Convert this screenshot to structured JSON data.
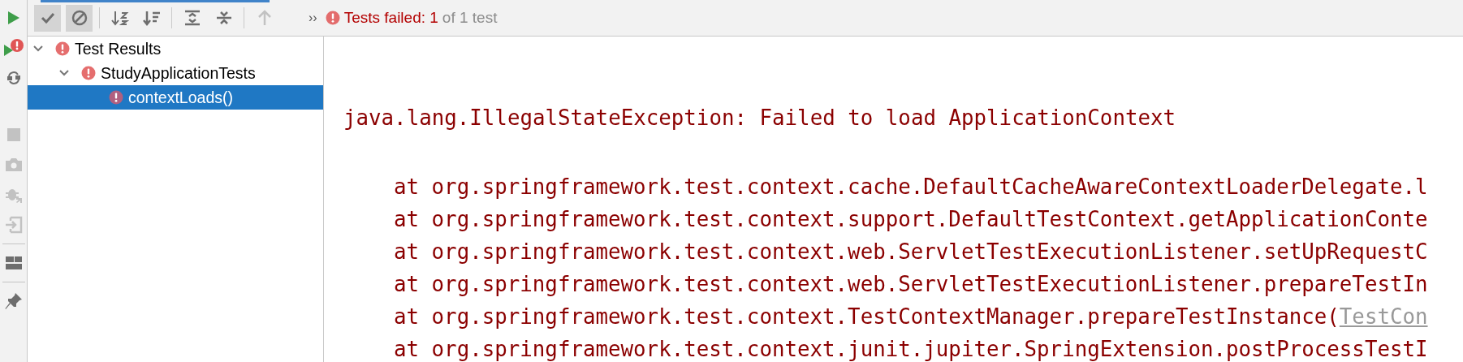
{
  "side_toolbar": [
    {
      "kind": "run",
      "disabled": false
    },
    {
      "kind": "rerun-failed",
      "disabled": false
    },
    {
      "kind": "auto-test",
      "disabled": false
    },
    {
      "kind": "stop",
      "disabled": true
    },
    {
      "kind": "camera",
      "disabled": true
    },
    {
      "kind": "bug",
      "disabled": true
    },
    {
      "kind": "import",
      "disabled": true
    },
    {
      "kind": "layout",
      "disabled": false
    },
    {
      "kind": "pin",
      "disabled": false
    }
  ],
  "toolbar": [
    {
      "kind": "check",
      "on": true,
      "disabled": false
    },
    {
      "kind": "ignored",
      "on": true,
      "disabled": false
    },
    {
      "kind": "sort-alpha",
      "on": false,
      "disabled": false
    },
    {
      "kind": "sort-duration",
      "on": false,
      "disabled": false
    },
    {
      "kind": "expand",
      "on": false,
      "disabled": false
    },
    {
      "kind": "collapse",
      "on": false,
      "disabled": false
    },
    {
      "kind": "up",
      "on": false,
      "disabled": true
    }
  ],
  "status": {
    "more": "››",
    "failed": "Tests failed: 1",
    "total": "of 1 test"
  },
  "tree": [
    {
      "label": "Test Results",
      "expanded": true,
      "selected": false,
      "children": [
        {
          "label": "StudyApplicationTests",
          "expanded": true,
          "selected": false,
          "children": [
            {
              "label": "contextLoads()",
              "selected": true
            }
          ]
        }
      ]
    }
  ],
  "console": [
    {
      "kind": "exception",
      "text": "java.lang.IllegalStateException: Failed to load ApplicationContext"
    },
    {
      "kind": "frame",
      "text": "at org.springframework.test.context.cache.DefaultCacheAwareContextLoaderDelegate.l"
    },
    {
      "kind": "frame",
      "text": "at org.springframework.test.context.support.DefaultTestContext.getApplicationConte"
    },
    {
      "kind": "frame",
      "text": "at org.springframework.test.context.web.ServletTestExecutionListener.setUpRequestC"
    },
    {
      "kind": "frame",
      "text": "at org.springframework.test.context.web.ServletTestExecutionListener.prepareTestIn"
    },
    {
      "kind": "frame",
      "text": "at org.springframework.test.context.TestContextManager.prepareTestInstance(",
      "link": "TestCon"
    },
    {
      "kind": "frame",
      "text": "at org.springframework.test.context.junit.jupiter.SpringExtension.postProcessTestI"
    }
  ]
}
